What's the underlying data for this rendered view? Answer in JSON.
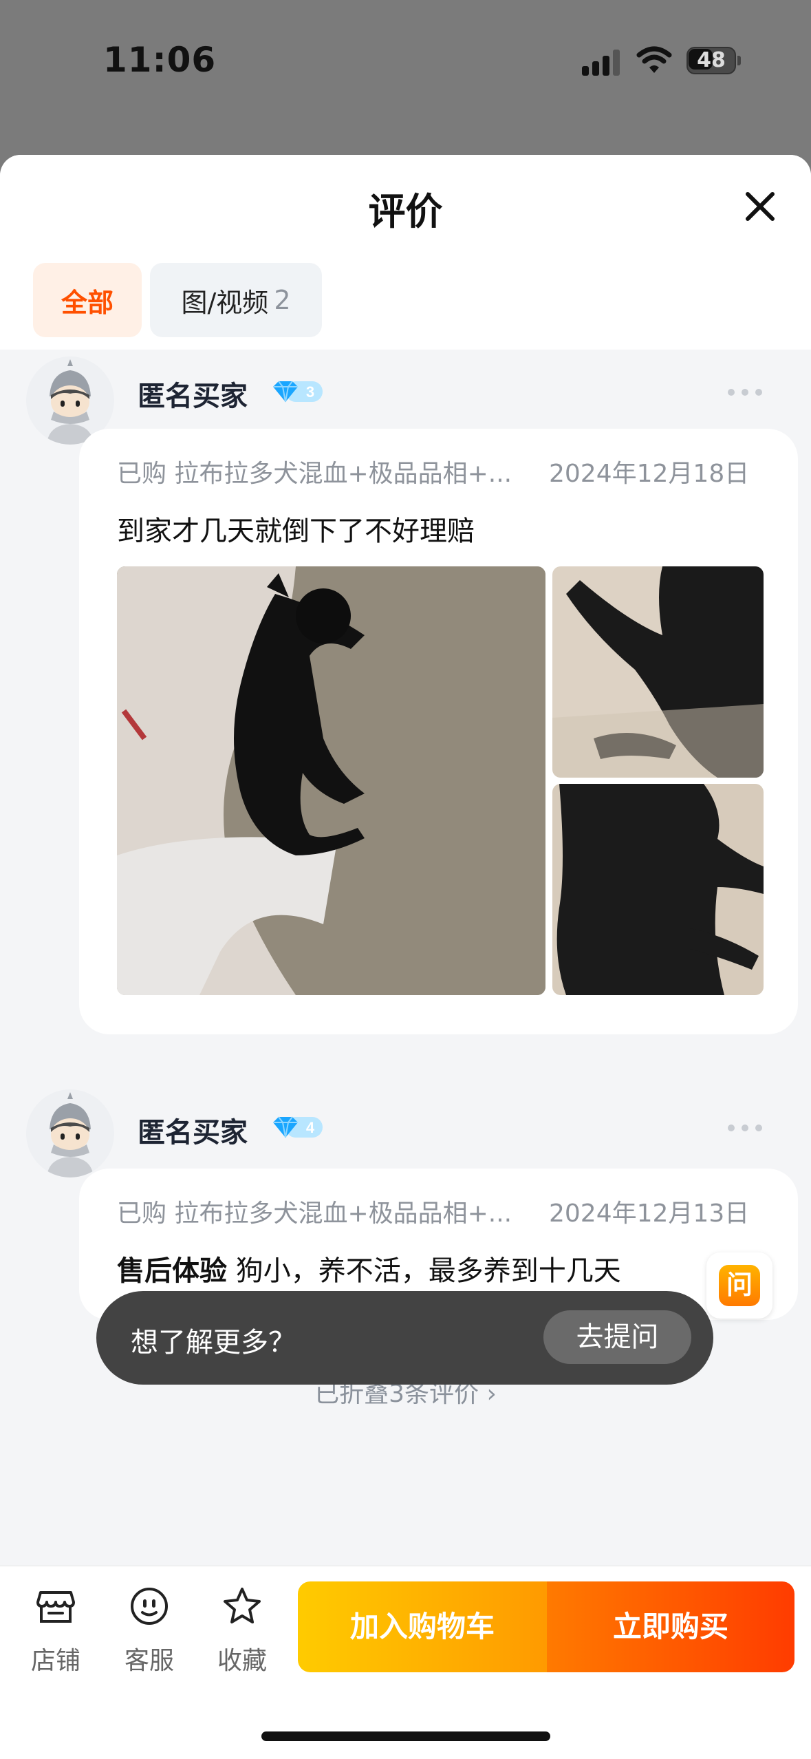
{
  "status_bar": {
    "time": "11:06",
    "battery": "48"
  },
  "sheet": {
    "title": "评价",
    "tabs": [
      {
        "label": "全部"
      },
      {
        "label": "图/视频",
        "count": "2"
      }
    ]
  },
  "reviews": [
    {
      "user": "匿名买家",
      "level": "3",
      "purchased": "已购 拉布拉多犬混血+极品品相+...",
      "date": "2024年12月18日",
      "text": "到家才几天就倒下了不好理赔",
      "photos": 3
    },
    {
      "user": "匿名买家",
      "level": "4",
      "purchased": "已购 拉布拉多犬混血+极品品相+...",
      "date": "2024年12月13日",
      "tag": "售后体验",
      "text": "狗小，养不活，最多养到十几天"
    }
  ],
  "folded": "已折叠3条评价 ›",
  "ask": {
    "float_label": "问",
    "prompt": "想了解更多？",
    "button": "去提问"
  },
  "bottom_bar": {
    "store": "店铺",
    "service": "客服",
    "favorite": "收藏",
    "add_to_cart": "加入购物车",
    "buy_now": "立即购买"
  },
  "colors": {
    "accent": "#ff5000",
    "cart_gradient": "#ffcb00",
    "buy_gradient": "#ff3c00"
  }
}
